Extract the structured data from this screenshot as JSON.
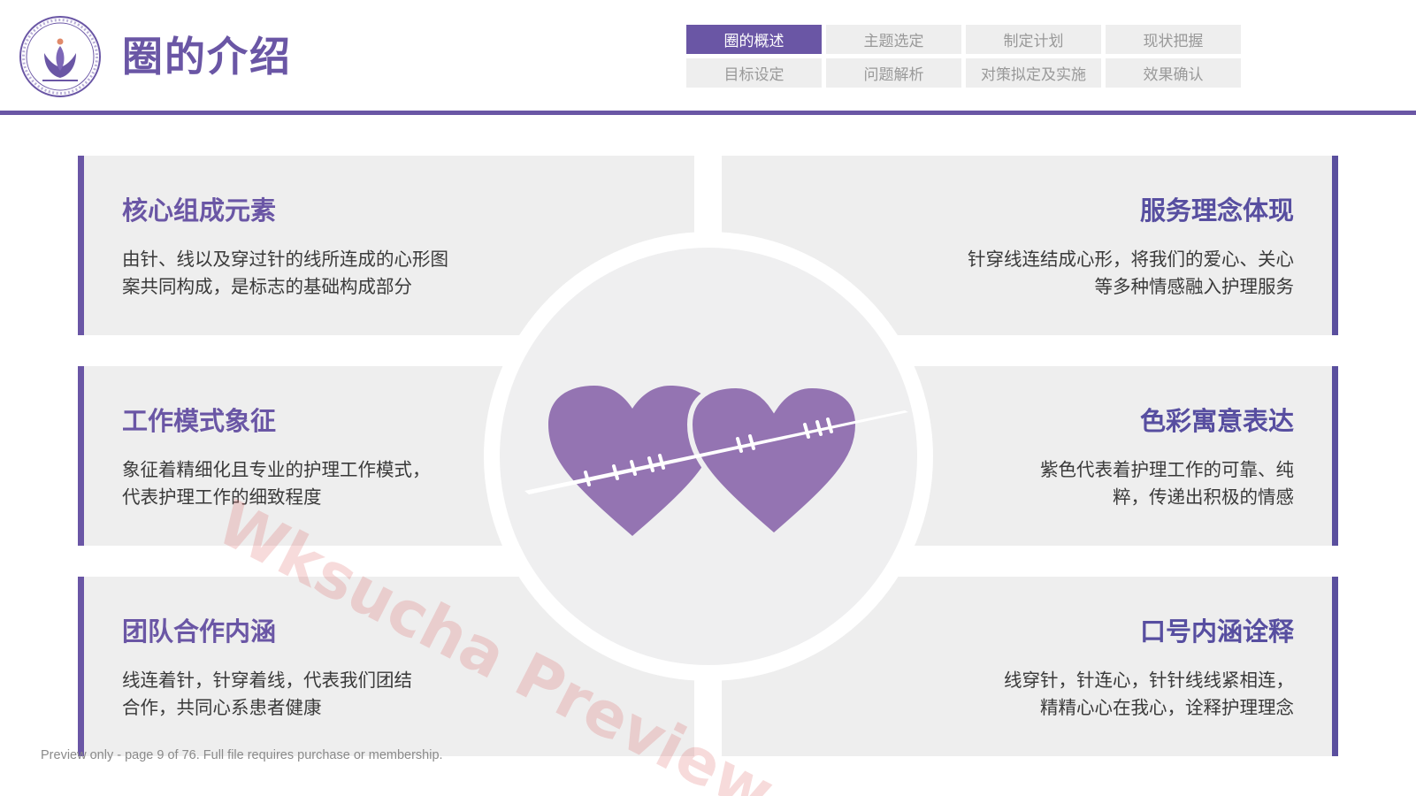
{
  "header": {
    "title": "圈的介绍",
    "nav_tabs": [
      {
        "label": "圈的概述",
        "active": true
      },
      {
        "label": "主题选定",
        "active": false
      },
      {
        "label": "制定计划",
        "active": false
      },
      {
        "label": "现状把握",
        "active": false
      },
      {
        "label": "目标设定",
        "active": false
      },
      {
        "label": "问题解析",
        "active": false
      },
      {
        "label": "对策拟定及实施",
        "active": false
      },
      {
        "label": "效果确认",
        "active": false
      }
    ]
  },
  "cards": {
    "core": {
      "title": "核心组成元素",
      "body": "由针、线以及穿过针的线所连成的心形图\n案共同构成，是标志的基础构成部分"
    },
    "service": {
      "title": "服务理念体现",
      "body": "针穿线连结成心形，将我们的爱心、关心\n等多种情感融入护理服务"
    },
    "work": {
      "title": "工作模式象征",
      "body": "象征着精细化且专业的护理工作模式，\n代表护理工作的细致程度"
    },
    "color": {
      "title": "色彩寓意表达",
      "body": "紫色代表着护理工作的可靠、纯\n粹，传递出积极的情感"
    },
    "team": {
      "title": "团队合作内涵",
      "body": "线连着针，针穿着线，代表我们团结\n合作，共同心系患者健康"
    },
    "slogan": {
      "title": "口号内涵诠释",
      "body": "线穿针，针连心，针针线线紧相连，\n精精心心在我心，诠释护理理念"
    }
  },
  "watermark": "Wksucha Preview",
  "footer_note": "Preview only - page 9 of 76. Full file requires purchase or membership.",
  "colors": {
    "accent": "#6a56a5",
    "heart": "#9474b2",
    "card_bg": "#eeeeee"
  },
  "icons": {
    "logo": "hospital-logo-icon",
    "center": "stitched-hearts-icon"
  }
}
